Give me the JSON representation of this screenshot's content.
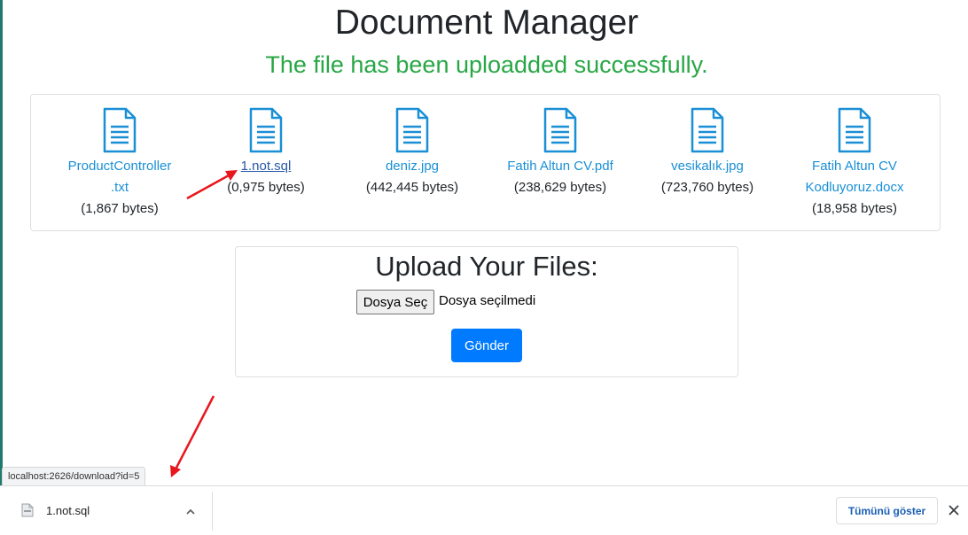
{
  "page": {
    "title": "Document Manager",
    "success_message": "The file has been uploadded successfully."
  },
  "files": [
    {
      "name_line1": "ProductController",
      "name_line2": ".txt",
      "size": "(1,867 bytes)",
      "icon": "document-icon"
    },
    {
      "name_line1": "1.not.sql",
      "name_line2": "",
      "size": "(0,975 bytes)",
      "icon": "document-icon"
    },
    {
      "name_line1": "deniz.jpg",
      "name_line2": "",
      "size": "(442,445 bytes)",
      "icon": "document-icon"
    },
    {
      "name_line1": "Fatih Altun CV.pdf",
      "name_line2": "",
      "size": "(238,629 bytes)",
      "icon": "document-icon"
    },
    {
      "name_line1": "vesikalık.jpg",
      "name_line2": "",
      "size": "(723,760 bytes)",
      "icon": "document-icon"
    },
    {
      "name_line1": "Fatih Altun CV",
      "name_line2": "Kodluyoruz.docx",
      "size": "(18,958 bytes)",
      "icon": "document-icon"
    }
  ],
  "upload": {
    "title": "Upload Your Files:",
    "choose_label": "Dosya Seç",
    "no_file_text": "Dosya seçilmedi",
    "submit_label": "Gönder"
  },
  "status_bar": {
    "url": "localhost:2626/download?id=5"
  },
  "download_bar": {
    "file_name": "1.not.sql",
    "show_all_label": "Tümünü göster",
    "close_icon": "close-icon",
    "chevron_icon": "chevron-up-icon",
    "file_icon": "file-icon"
  },
  "colors": {
    "success": "#28a745",
    "link": "#1a8fd6",
    "primary_button": "#007bff",
    "annotation_arrow": "#e8161d"
  }
}
